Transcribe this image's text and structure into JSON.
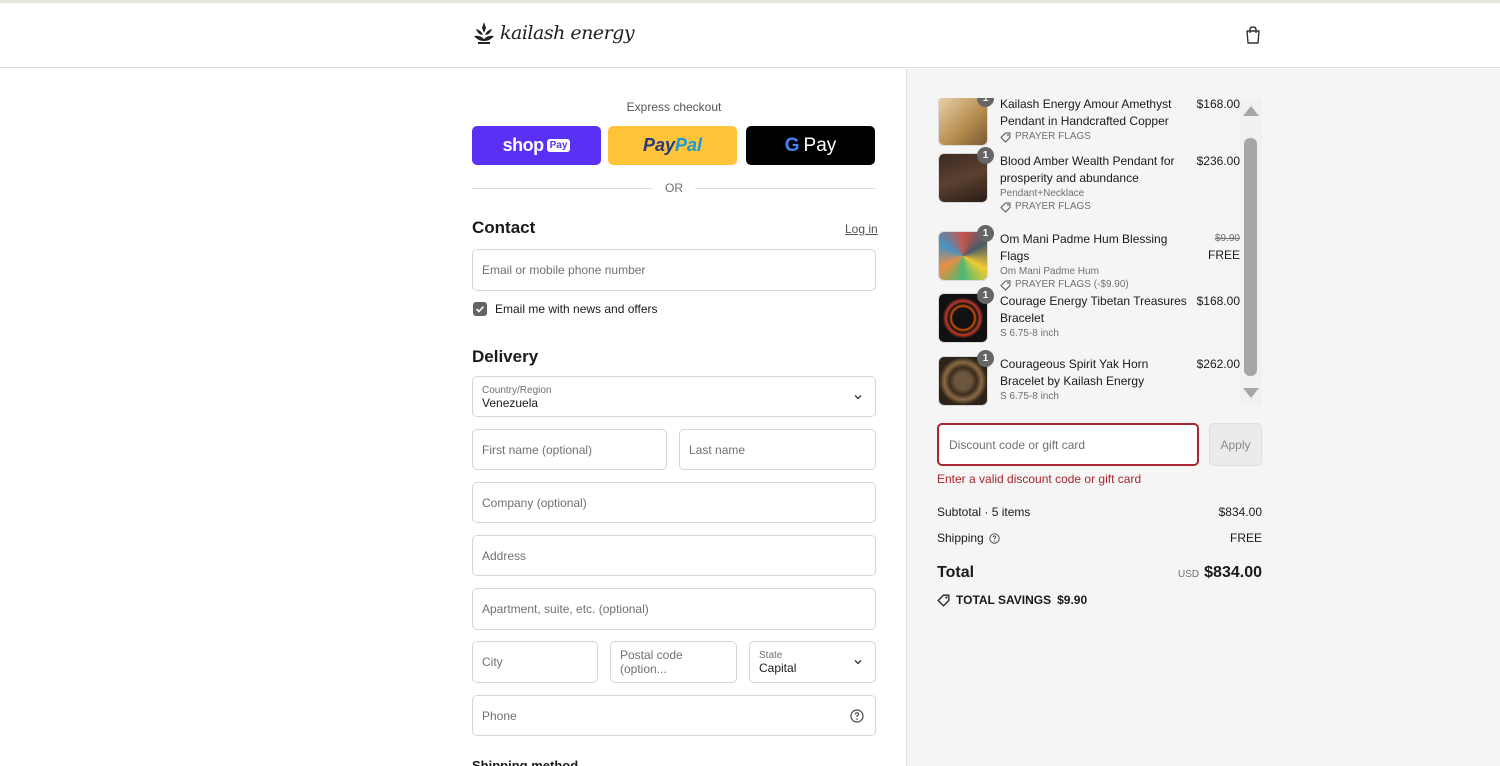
{
  "brand": {
    "logo_text": "kailash energy"
  },
  "express": {
    "title": "Express checkout",
    "shop_pay": {
      "word": "shop",
      "badge": "Pay"
    },
    "paypal": {
      "part1": "Pay",
      "part2": "Pal"
    },
    "gpay": {
      "g": "G",
      "word": "Pay"
    },
    "or_text": "OR"
  },
  "contact": {
    "title": "Contact",
    "login_label": "Log in",
    "email_placeholder": "Email or mobile phone number",
    "news_label": "Email me with news and offers",
    "news_checked": true
  },
  "delivery": {
    "title": "Delivery",
    "country_label": "Country/Region",
    "country_value": "Venezuela",
    "first_name_placeholder": "First name (optional)",
    "last_name_placeholder": "Last name",
    "company_placeholder": "Company (optional)",
    "address_placeholder": "Address",
    "apartment_placeholder": "Apartment, suite, etc. (optional)",
    "city_placeholder": "City",
    "postal_placeholder": "Postal code (option...",
    "state_label": "State",
    "state_value": "Capital",
    "phone_placeholder": "Phone",
    "shipping_method_title": "Shipping method"
  },
  "order": {
    "items": [
      {
        "name": "Kailash Energy Amour Amethyst Pendant in Handcrafted Copper",
        "variant": "",
        "discount": "PRAYER FLAGS",
        "price": "$168.00",
        "original_price": "",
        "qty": "1",
        "thumb_color": "#c9a46a"
      },
      {
        "name": "Blood Amber Wealth Pendant for prosperity and abundance",
        "variant": "Pendant+Necklace",
        "discount": "PRAYER FLAGS",
        "price": "$236.00",
        "original_price": "",
        "qty": "1",
        "thumb_color": "#4a3528"
      },
      {
        "name": "Om Mani Padme Hum Blessing Flags",
        "variant": "Om Mani Padme Hum",
        "discount": "PRAYER FLAGS (-$9.90)",
        "price": "FREE",
        "original_price": "$9.90",
        "qty": "1",
        "thumb_color": "#d7a06b"
      },
      {
        "name": "Courage Energy Tibetan Treasures Bracelet",
        "variant": "S 6.75-8 inch",
        "discount": "",
        "price": "$168.00",
        "original_price": "",
        "qty": "1",
        "thumb_color": "#1c1c1c"
      },
      {
        "name": "Courageous Spirit Yak Horn Bracelet by Kailash Energy",
        "variant": "S 6.75-8 inch",
        "discount": "",
        "price": "$262.00",
        "original_price": "",
        "qty": "1",
        "thumb_color": "#5a4631"
      }
    ],
    "discount_placeholder": "Discount code or gift card",
    "apply_label": "Apply",
    "discount_error": "Enter a valid discount code or gift card",
    "subtotal_label": "Subtotal · 5 items",
    "subtotal_value": "$834.00",
    "shipping_label": "Shipping",
    "shipping_value": "FREE",
    "total_label": "Total",
    "currency": "USD",
    "total_value": "$834.00",
    "savings_label": "TOTAL SAVINGS",
    "savings_value": "$9.90"
  },
  "colors": {
    "shop_pay": "#5a31f4",
    "paypal": "#ffc439",
    "gpay": "#000000",
    "error": "#a7282e"
  }
}
